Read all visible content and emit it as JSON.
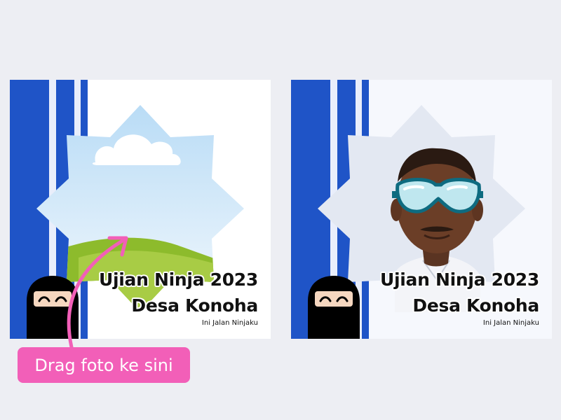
{
  "frames": [
    {
      "title_line1": "Ujian Ninja 2023",
      "title_line2": "Desa Konoha",
      "subtitle": "Ini Jalan Ninjaku",
      "photo_state": "placeholder",
      "photo_icon": "image-placeholder-icon"
    },
    {
      "title_line1": "Ujian Ninja 2023",
      "title_line2": "Desa Konoha",
      "subtitle": "Ini Jalan Ninjaku",
      "photo_state": "filled",
      "photo_icon": "portrait-photo"
    }
  ],
  "hint": {
    "label": "Drag foto ke sini",
    "icon": "curved-arrow-icon"
  },
  "colors": {
    "background": "#edeef3",
    "stripe_blue": "#1f54c7",
    "hint_pink": "#f25fb8",
    "goggles": "#0e6b80"
  }
}
